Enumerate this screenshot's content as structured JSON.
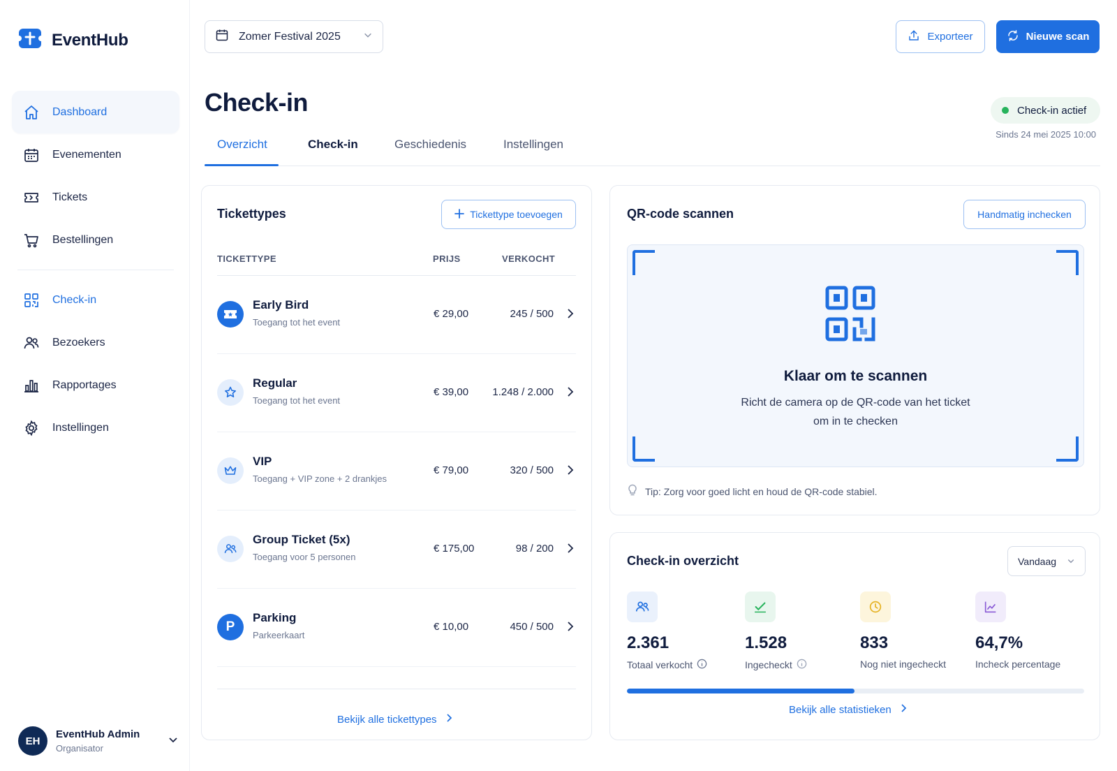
{
  "app": {
    "name": "EventHub"
  },
  "sidebar": {
    "items": [
      {
        "label": "Dashboard"
      },
      {
        "label": "Evenementen"
      },
      {
        "label": "Tickets"
      },
      {
        "label": "Bestellingen"
      },
      {
        "label": "Check-in"
      },
      {
        "label": "Bezoekers"
      },
      {
        "label": "Rapportages"
      },
      {
        "label": "Instellingen"
      }
    ],
    "user": {
      "initials": "EH",
      "name": "EventHub Admin",
      "role": "Organisator"
    }
  },
  "topbar": {
    "event": "Zomer Festival 2025",
    "export_label": "Exporteer",
    "scan_label": "Nieuwe scan"
  },
  "page": {
    "title": "Check-in",
    "status": "Check-in actief",
    "status_since": "Sinds 24 mei 2025 10:00",
    "tabs": [
      "Overzicht",
      "Check-in",
      "Geschiedenis",
      "Instellingen"
    ]
  },
  "tickets": {
    "title": "Tickettypes",
    "add_label": "Tickettype toevoegen",
    "columns": [
      "TICKETTYPE",
      "PRIJS",
      "VERKOCHT"
    ],
    "rows": [
      {
        "name": "Early Bird",
        "desc": "Toegang tot het event",
        "price": "€ 29,00",
        "sold": "245 / 500",
        "icon": "ticket-icon"
      },
      {
        "name": "Regular",
        "desc": "Toegang tot het event",
        "price": "€ 39,00",
        "sold": "1.248 / 2.000",
        "icon": "star-icon"
      },
      {
        "name": "VIP",
        "desc": "Toegang + VIP zone + 2 drankjes",
        "price": "€ 79,00",
        "sold": "320 / 500",
        "icon": "crown-icon"
      },
      {
        "name": "Group Ticket (5x)",
        "desc": "Toegang voor 5 personen",
        "price": "€ 175,00",
        "sold": "98 / 200",
        "icon": "users-icon"
      },
      {
        "name": "Parking",
        "desc": "Parkeerkaart",
        "price": "€ 10,00",
        "sold": "450 / 500",
        "icon": "parking-icon",
        "icon_text": "P"
      }
    ],
    "view_all": "Bekijk alle tickettypes"
  },
  "scan": {
    "title": "QR-code scannen",
    "manual_label": "Handmatig inchecken",
    "ready_title": "Klaar om te scannen",
    "ready_line1": "Richt de camera op de QR-code van het ticket",
    "ready_line2": "om in te checken",
    "tip": "Tip: Zorg voor goed licht en houd de QR-code stabiel."
  },
  "overview": {
    "title": "Check-in overzicht",
    "period": "Vandaag",
    "stats": [
      {
        "value": "2.361",
        "label": "Totaal verkocht"
      },
      {
        "value": "1.528",
        "label": "Ingecheckt"
      },
      {
        "value": "833",
        "label": "Nog niet ingecheckt"
      },
      {
        "value": "64,7%",
        "label": "Incheck percentage"
      }
    ],
    "progress": 0.497,
    "view_all": "Bekijk alle statistieken"
  },
  "colors": {
    "accent": "#1f6fe0",
    "success": "#27b35c",
    "text": "#0f1b3d"
  }
}
